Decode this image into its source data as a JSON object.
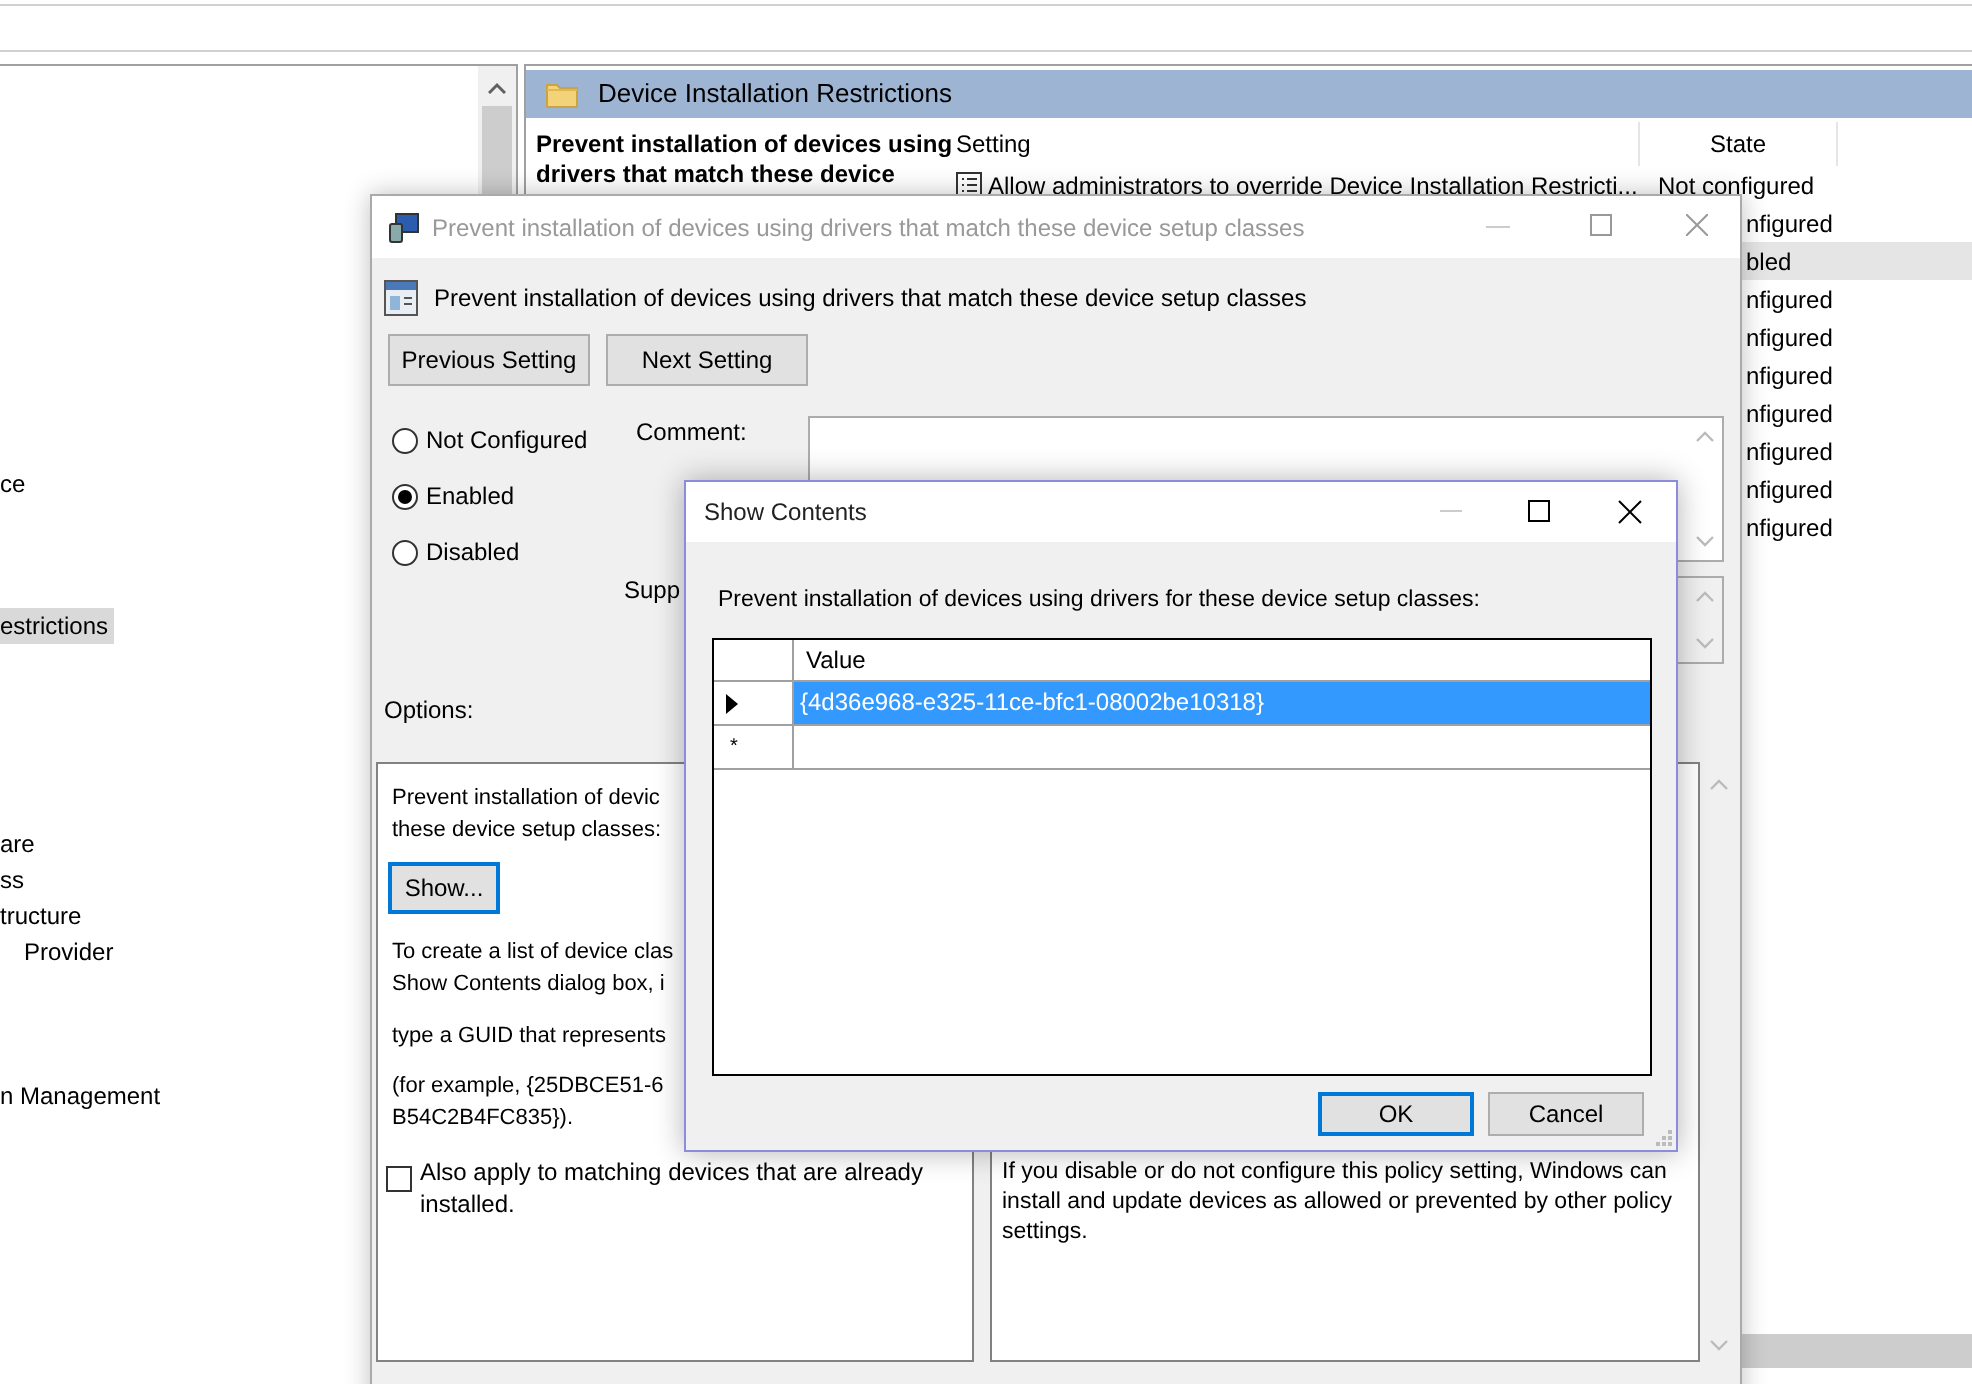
{
  "tree": {
    "items": [
      {
        "label": "ce",
        "selected": false
      },
      {
        "label": "estrictions",
        "selected": true
      },
      {
        "label": "are",
        "selected": false
      },
      {
        "label": "ss",
        "selected": false
      },
      {
        "label": "tructure",
        "selected": false
      },
      {
        "label": "Provider",
        "selected": false
      },
      {
        "label": "n Management",
        "selected": false
      }
    ]
  },
  "details": {
    "header": "Device Installation Restrictions",
    "description_lines": [
      "Prevent installation of devices using",
      "drivers that match these device"
    ],
    "columns": [
      "Setting",
      "State"
    ],
    "rows": [
      {
        "setting": "Allow administrators to override Device Installation Restricti...",
        "state": "Not configured",
        "selected": false
      },
      {
        "state": "nfigured",
        "selected": false
      },
      {
        "state": "bled",
        "selected": true
      },
      {
        "state": "nfigured",
        "selected": false
      },
      {
        "state": "nfigured",
        "selected": false
      },
      {
        "state": "nfigured",
        "selected": false
      },
      {
        "state": "nfigured",
        "selected": false
      },
      {
        "state": "nfigured",
        "selected": false
      },
      {
        "state": "nfigured",
        "selected": false
      },
      {
        "state": "nfigured",
        "selected": false
      }
    ]
  },
  "policy_dialog": {
    "title": "Prevent installation of devices using drivers that match these device setup classes",
    "active": false,
    "heading": "Prevent installation of devices using drivers that match these device setup classes",
    "nav_buttons": [
      "Previous Setting",
      "Next Setting"
    ],
    "options": [
      {
        "label": "Not Configured",
        "selected": false
      },
      {
        "label": "Enabled",
        "selected": true
      },
      {
        "label": "Disabled",
        "selected": false
      }
    ],
    "comment_label": "Comment:",
    "supported_label": "Supp",
    "options_label": "Options:",
    "options_panel": {
      "paragraphs": [
        [
          "Prevent installation of devic",
          "these device setup classes:"
        ],
        [
          "To create a list of device clas",
          "Show Contents dialog box, i"
        ],
        [
          "type a GUID that represents"
        ],
        [
          "(for example, {25DBCE51-6",
          "B54C2B4FC835})."
        ]
      ],
      "show_button": {
        "label": "Show...",
        "focused": true
      },
      "checkbox": {
        "label": "Also apply to matching devices that are already installed.",
        "checked": false
      }
    },
    "help_text": "If you disable or do not configure this policy setting, Windows can install and update devices as allowed or prevented by other policy settings."
  },
  "show_contents": {
    "title": "Show Contents",
    "active": true,
    "prompt": "Prevent installation of devices using drivers for these device setup classes:",
    "column": "Value",
    "rows": [
      {
        "value": "{4d36e968-e325-11ce-bfc1-08002be10318}",
        "selected": true
      }
    ],
    "new_row_marker": "*",
    "buttons": [
      {
        "label": "OK",
        "default": true
      },
      {
        "label": "Cancel",
        "default": false
      }
    ]
  }
}
